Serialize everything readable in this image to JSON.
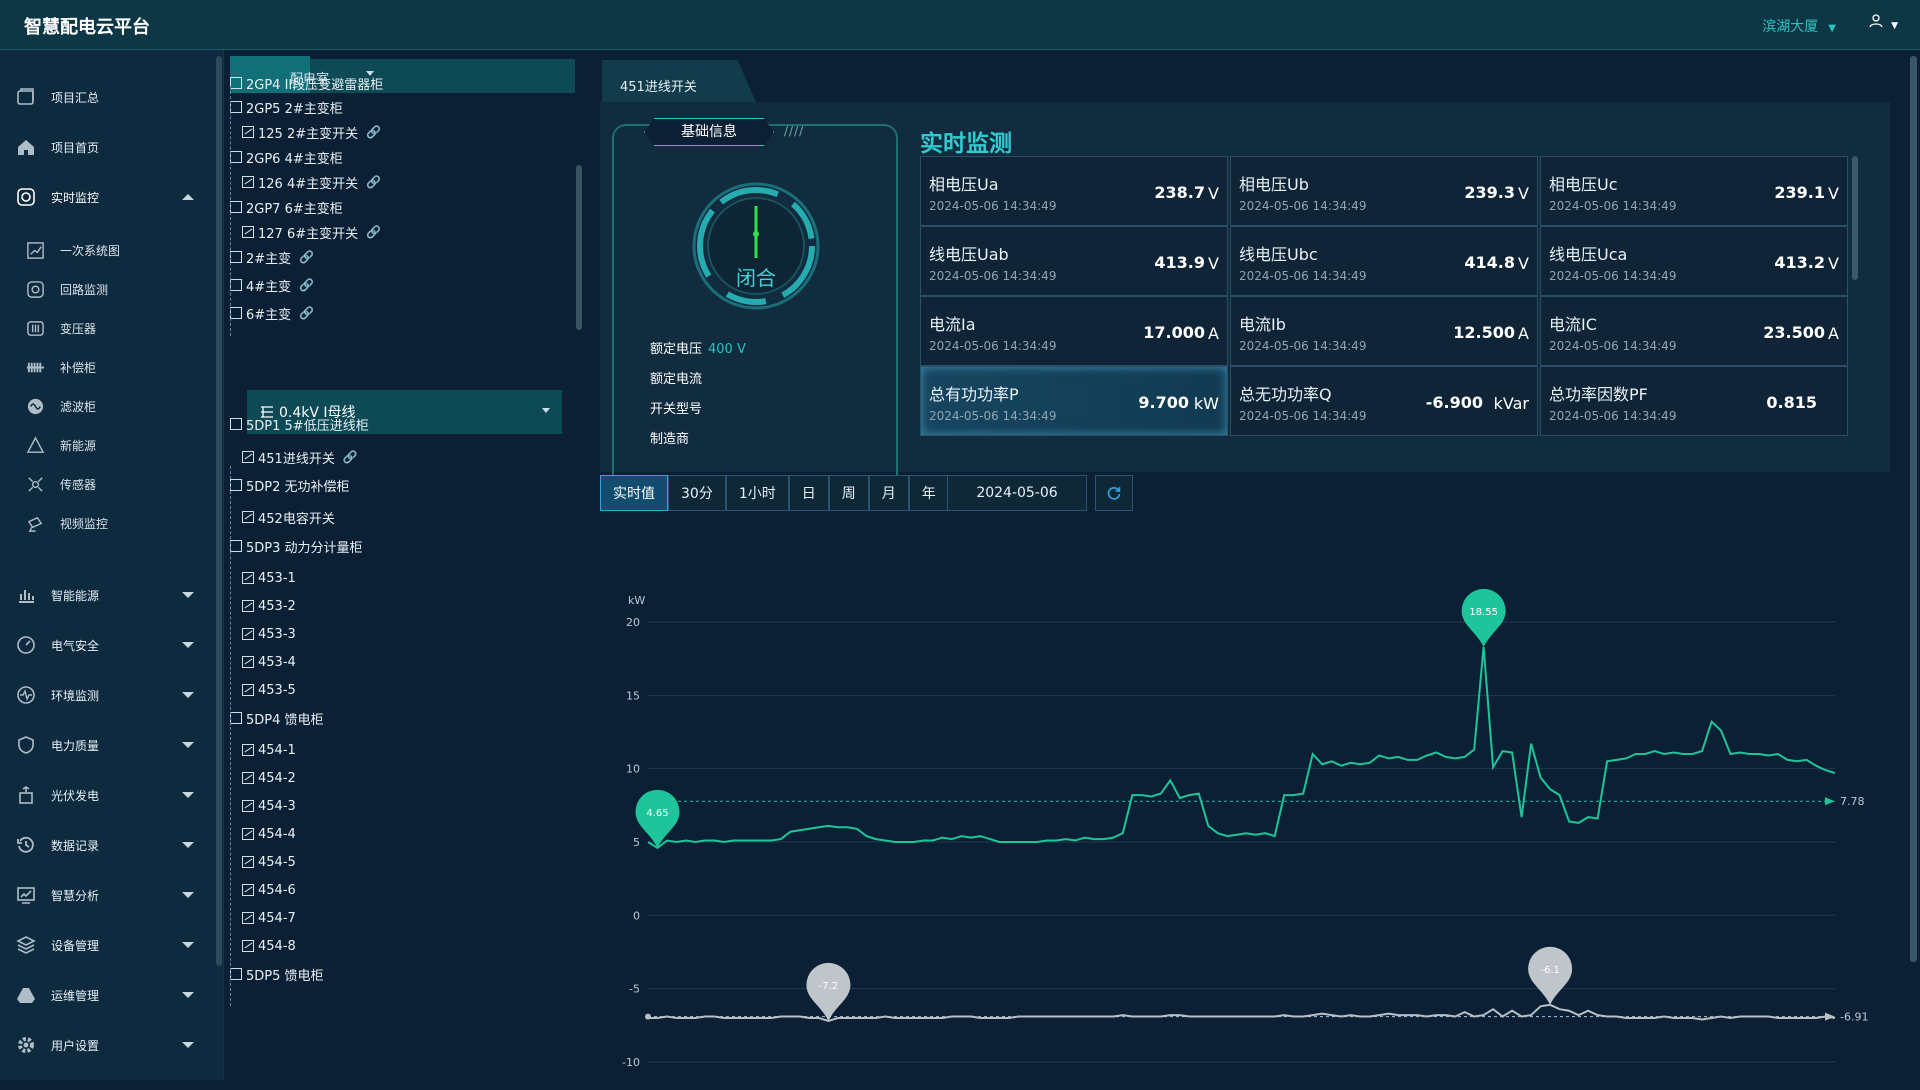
{
  "app": {
    "title": "智慧配电云平台",
    "building": "滨湖大厦",
    "user_icon": "user-icon"
  },
  "colors": {
    "accent": "#2ac3c3",
    "series_p": "#1ec59a",
    "series_q": "#b8bfc6",
    "bg": "#0c2035"
  },
  "sidebar": {
    "items": [
      {
        "label": "项目汇总",
        "icon": "summary-icon"
      },
      {
        "label": "项目首页",
        "icon": "home-icon"
      },
      {
        "label": "实时监控",
        "icon": "camera-icon",
        "expanded": true
      },
      {
        "label": "智能能源",
        "icon": "bar-chart-icon"
      },
      {
        "label": "电气安全",
        "icon": "gauge-icon"
      },
      {
        "label": "环境监测",
        "icon": "pulse-icon"
      },
      {
        "label": "电力质量",
        "icon": "shield-icon"
      },
      {
        "label": "光伏发电",
        "icon": "solar-icon"
      },
      {
        "label": "数据记录",
        "icon": "history-icon"
      },
      {
        "label": "智慧分析",
        "icon": "analysis-icon"
      },
      {
        "label": "设备管理",
        "icon": "layers-icon"
      },
      {
        "label": "运维管理",
        "icon": "drive-icon"
      },
      {
        "label": "用户设置",
        "icon": "gear-icon"
      }
    ],
    "sub_items": [
      {
        "label": "一次系统图",
        "icon": "diagram-icon"
      },
      {
        "label": "回路监测",
        "icon": "loop-icon"
      },
      {
        "label": "变压器",
        "icon": "transformer-icon"
      },
      {
        "label": "补偿柜",
        "icon": "capacitor-icon"
      },
      {
        "label": "滤波柜",
        "icon": "filter-icon"
      },
      {
        "label": "新能源",
        "icon": "triangle-icon"
      },
      {
        "label": "传感器",
        "icon": "sensor-icon"
      },
      {
        "label": "视频监控",
        "icon": "video-icon"
      }
    ]
  },
  "tree": {
    "room": "配电室",
    "bus": "0.4kV I母线",
    "nodes_a": [
      {
        "label": "2GP4 II段压变避雷器柜",
        "type": "cab"
      },
      {
        "label": "2GP5 2#主变柜",
        "type": "cab",
        "toggle": true
      },
      {
        "label": "125 2#主变开关",
        "type": "sw",
        "link": true
      },
      {
        "label": "2GP6 4#主变柜",
        "type": "cab",
        "toggle": true
      },
      {
        "label": "126 4#主变开关",
        "type": "sw",
        "link": true
      },
      {
        "label": "2GP7 6#主变柜",
        "type": "cab",
        "toggle": true
      },
      {
        "label": "127 6#主变开关",
        "type": "sw",
        "link": true
      },
      {
        "label": "2#主变",
        "type": "tr",
        "link": true
      },
      {
        "label": "4#主变",
        "type": "tr",
        "link": true
      },
      {
        "label": "6#主变",
        "type": "tr",
        "link": true
      }
    ],
    "nodes_b": [
      {
        "label": "5DP1 5#低压进线柜",
        "type": "cab",
        "toggle": true
      },
      {
        "label": "451进线开关",
        "type": "sw",
        "link": true
      },
      {
        "label": "5DP2 无功补偿柜",
        "type": "cab",
        "toggle": true
      },
      {
        "label": "452电容开关",
        "type": "sw"
      },
      {
        "label": "5DP3 动力分计量柜",
        "type": "cab",
        "toggle": true
      },
      {
        "label": "453-1",
        "type": "sw"
      },
      {
        "label": "453-2",
        "type": "sw"
      },
      {
        "label": "453-3",
        "type": "sw"
      },
      {
        "label": "453-4",
        "type": "sw"
      },
      {
        "label": "453-5",
        "type": "sw"
      },
      {
        "label": "5DP4 馈电柜",
        "type": "cab",
        "toggle": true
      },
      {
        "label": "454-1",
        "type": "sw"
      },
      {
        "label": "454-2",
        "type": "sw"
      },
      {
        "label": "454-3",
        "type": "sw"
      },
      {
        "label": "454-4",
        "type": "sw"
      },
      {
        "label": "454-5",
        "type": "sw"
      },
      {
        "label": "454-6",
        "type": "sw"
      },
      {
        "label": "454-7",
        "type": "sw"
      },
      {
        "label": "454-8",
        "type": "sw"
      },
      {
        "label": "5DP5 馈电柜",
        "type": "cab",
        "toggle": true
      }
    ]
  },
  "main": {
    "tab": "451进线开关",
    "basic": {
      "title": "基础信息",
      "deco": "////",
      "state": "闭合",
      "rows": [
        {
          "label": "额定电压",
          "value": "400 V"
        },
        {
          "label": "额定电流",
          "value": ""
        },
        {
          "label": "开关型号",
          "value": ""
        },
        {
          "label": "制造商",
          "value": ""
        }
      ]
    },
    "realtime_title": "实时监测",
    "cells": [
      {
        "name": "相电压Ua",
        "time": "2024-05-06 14:34:49",
        "value": "238.7",
        "unit": "V"
      },
      {
        "name": "相电压Ub",
        "time": "2024-05-06 14:34:49",
        "value": "239.3",
        "unit": "V"
      },
      {
        "name": "相电压Uc",
        "time": "2024-05-06 14:34:49",
        "value": "239.1",
        "unit": "V"
      },
      {
        "name": "线电压Uab",
        "time": "2024-05-06 14:34:49",
        "value": "413.9",
        "unit": "V"
      },
      {
        "name": "线电压Ubc",
        "time": "2024-05-06 14:34:49",
        "value": "414.8",
        "unit": "V"
      },
      {
        "name": "线电压Uca",
        "time": "2024-05-06 14:34:49",
        "value": "413.2",
        "unit": "V"
      },
      {
        "name": "电流Ia",
        "time": "2024-05-06 14:34:49",
        "value": "17.000",
        "unit": "A"
      },
      {
        "name": "电流Ib",
        "time": "2024-05-06 14:34:49",
        "value": "12.500",
        "unit": "A"
      },
      {
        "name": "电流IC",
        "time": "2024-05-06 14:34:49",
        "value": "23.500",
        "unit": "A"
      },
      {
        "name": "总有功功率P",
        "time": "2024-05-06 14:34:49",
        "value": "9.700",
        "unit": "kW",
        "highlight": true
      },
      {
        "name": "总无功功率Q",
        "time": "2024-05-06 14:34:49",
        "value": "-6.900",
        "unit": "kVar"
      },
      {
        "name": "总功率因数PF",
        "time": "2024-05-06 14:34:49",
        "value": "0.815",
        "unit": ""
      }
    ],
    "controls": {
      "buttons": [
        "实时值",
        "30分",
        "1小时",
        "日",
        "周",
        "月",
        "年"
      ],
      "active": "实时值",
      "date": "2024-05-06",
      "refresh_icon": "refresh-icon"
    }
  },
  "chart_data": {
    "type": "line",
    "ylabel": "kW",
    "ylim": [
      -10,
      20
    ],
    "yticks": [
      20,
      15,
      10,
      5,
      0,
      -5,
      -10
    ],
    "grid": true,
    "series": [
      {
        "key": "P",
        "values": [
          5.0,
          4.6,
          5.1,
          5.0,
          5.1,
          5.0,
          5.1,
          5.1,
          5.0,
          5.1,
          5.1,
          5.1,
          5.1,
          5.1,
          5.2,
          5.7,
          5.8,
          5.9,
          6.0,
          6.1,
          6.0,
          6.0,
          5.9,
          5.4,
          5.2,
          5.1,
          5.0,
          5.0,
          5.0,
          5.1,
          5.1,
          5.3,
          5.2,
          5.4,
          5.3,
          5.4,
          5.2,
          5.0,
          5.0,
          5.0,
          5.0,
          5.0,
          5.1,
          5.1,
          5.2,
          5.1,
          5.3,
          5.2,
          5.2,
          5.3,
          5.6,
          8.2,
          8.2,
          8.1,
          8.3,
          9.2,
          8.0,
          8.2,
          8.3,
          6.1,
          5.6,
          5.4,
          5.5,
          5.6,
          5.5,
          5.6,
          5.4,
          8.2,
          8.2,
          8.3,
          11.0,
          10.3,
          10.5,
          10.2,
          10.4,
          10.3,
          10.4,
          10.9,
          10.7,
          10.8,
          10.6,
          10.6,
          10.9,
          11.1,
          10.8,
          10.7,
          10.8,
          11.3,
          18.3,
          10.1,
          11.2,
          11.1,
          6.7,
          11.7,
          9.4,
          8.6,
          8.2,
          6.4,
          6.3,
          6.7,
          6.6,
          10.5,
          10.6,
          10.7,
          11.0,
          11.0,
          11.2,
          11.0,
          11.1,
          11.0,
          11.0,
          11.2,
          13.2,
          12.6,
          11.0,
          11.1,
          11.0,
          11.0,
          10.9,
          11.0,
          10.6,
          10.5,
          10.6,
          10.2,
          9.9,
          9.7
        ],
        "max_label": "18.55",
        "min_label": "4.65",
        "avg_label": "7.78"
      },
      {
        "key": "Q",
        "values": [
          -7.0,
          -7.0,
          -6.9,
          -7.0,
          -7.0,
          -7.0,
          -6.9,
          -6.9,
          -7.0,
          -7.0,
          -7.0,
          -7.0,
          -7.0,
          -7.0,
          -6.9,
          -6.9,
          -6.9,
          -7.0,
          -7.0,
          -7.2,
          -7.0,
          -7.0,
          -7.0,
          -7.0,
          -7.0,
          -6.9,
          -7.0,
          -7.0,
          -7.0,
          -7.0,
          -7.0,
          -7.0,
          -6.9,
          -6.9,
          -6.9,
          -7.0,
          -7.0,
          -7.0,
          -7.0,
          -6.9,
          -6.9,
          -6.9,
          -6.9,
          -6.9,
          -6.9,
          -6.9,
          -6.9,
          -6.9,
          -6.9,
          -6.9,
          -6.8,
          -6.9,
          -6.9,
          -6.9,
          -6.9,
          -6.8,
          -6.8,
          -6.9,
          -6.9,
          -6.9,
          -6.9,
          -6.9,
          -6.9,
          -6.9,
          -6.9,
          -6.9,
          -6.9,
          -6.8,
          -6.9,
          -6.9,
          -6.8,
          -6.7,
          -6.8,
          -6.9,
          -6.8,
          -6.9,
          -6.9,
          -6.8,
          -6.7,
          -6.8,
          -6.8,
          -6.8,
          -6.9,
          -6.8,
          -6.8,
          -6.9,
          -6.6,
          -6.9,
          -6.8,
          -6.4,
          -6.9,
          -6.5,
          -6.9,
          -6.8,
          -6.2,
          -6.1,
          -6.4,
          -6.5,
          -6.8,
          -6.5,
          -6.8,
          -6.9,
          -6.9,
          -7.0,
          -7.0,
          -7.0,
          -7.0,
          -6.9,
          -7.0,
          -7.0,
          -7.0,
          -7.1,
          -7.0,
          -6.9,
          -7.0,
          -6.9,
          -6.9,
          -6.9,
          -6.9,
          -7.0,
          -7.0,
          -7.0,
          -7.0,
          -7.0,
          -6.9,
          -7.0
        ],
        "max_label": "-6.1",
        "min_label": "-7.2",
        "avg_label": "-6.91"
      }
    ]
  }
}
